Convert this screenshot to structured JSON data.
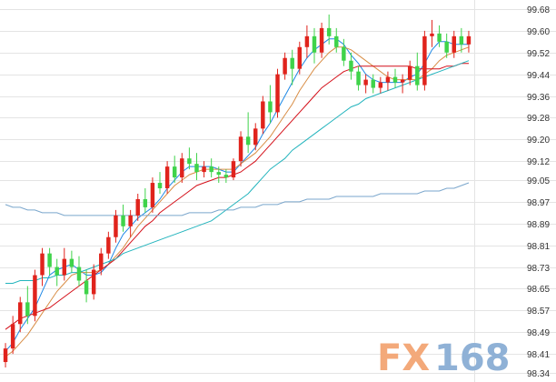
{
  "chart_data": {
    "type": "line",
    "subtype": "candlestick",
    "title": "",
    "xlabel": "",
    "ylabel": "",
    "ylim": [
      98.34,
      99.68
    ],
    "y_ticks": [
      "99.68",
      "99.60",
      "99.52",
      "99.44",
      "99.36",
      "99.28",
      "99.20",
      "99.12",
      "99.05",
      "98.97",
      "98.89",
      "98.81",
      "98.73",
      "98.65",
      "98.57",
      "98.49",
      "98.41",
      "98.34"
    ],
    "y_axis_position": "right",
    "grid": "horizontal",
    "x_labels": [],
    "colors": {
      "up": "#e0231c",
      "down": "#3fd34a",
      "ma5": "#1e88e5",
      "ma10": "#d88d45",
      "ma20": "#d40f19",
      "ma60": "#23b4bd",
      "ma120": "#7aa6cc"
    },
    "series": [
      {
        "kind": "candles",
        "ohlc": [
          [
            98.38,
            98.45,
            98.36,
            98.43
          ],
          [
            98.43,
            98.55,
            98.41,
            98.52
          ],
          [
            98.52,
            98.62,
            98.49,
            98.6
          ],
          [
            98.6,
            98.66,
            98.52,
            98.55
          ],
          [
            98.55,
            98.72,
            98.53,
            98.7
          ],
          [
            98.7,
            98.8,
            98.66,
            98.78
          ],
          [
            98.78,
            98.8,
            98.7,
            98.73
          ],
          [
            98.73,
            98.76,
            98.66,
            98.7
          ],
          [
            98.7,
            98.8,
            98.68,
            98.76
          ],
          [
            98.76,
            98.79,
            98.71,
            98.73
          ],
          [
            98.73,
            98.77,
            98.66,
            98.68
          ],
          [
            98.68,
            98.72,
            98.6,
            98.63
          ],
          [
            98.63,
            98.74,
            98.61,
            98.72
          ],
          [
            98.72,
            98.8,
            98.7,
            98.78
          ],
          [
            98.78,
            98.86,
            98.76,
            98.84
          ],
          [
            98.84,
            98.94,
            98.82,
            98.92
          ],
          [
            98.92,
            98.96,
            98.86,
            98.88
          ],
          [
            98.88,
            98.94,
            98.84,
            98.92
          ],
          [
            98.92,
            99.0,
            98.9,
            98.98
          ],
          [
            98.98,
            99.02,
            98.93,
            98.95
          ],
          [
            98.95,
            99.06,
            98.93,
            99.04
          ],
          [
            99.04,
            99.08,
            99.0,
            99.02
          ],
          [
            99.02,
            99.12,
            99.0,
            99.1
          ],
          [
            99.1,
            99.14,
            99.04,
            99.06
          ],
          [
            99.06,
            99.15,
            99.04,
            99.13
          ],
          [
            99.13,
            99.17,
            99.09,
            99.11
          ],
          [
            99.11,
            99.15,
            99.05,
            99.08
          ],
          [
            99.08,
            99.12,
            99.06,
            99.1
          ],
          [
            99.1,
            99.13,
            99.06,
            99.08
          ],
          [
            99.08,
            99.1,
            99.04,
            99.07
          ],
          [
            99.07,
            99.09,
            99.04,
            99.06
          ],
          [
            99.06,
            99.13,
            99.05,
            99.12
          ],
          [
            99.12,
            99.23,
            99.1,
            99.21
          ],
          [
            99.21,
            99.3,
            99.15,
            99.18
          ],
          [
            99.18,
            99.26,
            99.16,
            99.24
          ],
          [
            99.24,
            99.36,
            99.22,
            99.34
          ],
          [
            99.34,
            99.4,
            99.26,
            99.3
          ],
          [
            99.3,
            99.46,
            99.28,
            99.44
          ],
          [
            99.44,
            99.52,
            99.42,
            99.5
          ],
          [
            99.5,
            99.53,
            99.4,
            99.46
          ],
          [
            99.46,
            99.56,
            99.44,
            99.54
          ],
          [
            99.54,
            99.62,
            99.5,
            99.58
          ],
          [
            99.58,
            99.61,
            99.48,
            99.52
          ],
          [
            99.52,
            99.63,
            99.5,
            99.61
          ],
          [
            99.61,
            99.66,
            99.55,
            99.58
          ],
          [
            99.58,
            99.61,
            99.52,
            99.54
          ],
          [
            99.54,
            99.57,
            99.47,
            99.49
          ],
          [
            99.49,
            99.52,
            99.42,
            99.45
          ],
          [
            99.45,
            99.47,
            99.38,
            99.4
          ],
          [
            99.4,
            99.44,
            99.37,
            99.42
          ],
          [
            99.42,
            99.44,
            99.37,
            99.39
          ],
          [
            99.39,
            99.43,
            99.37,
            99.41
          ],
          [
            99.41,
            99.45,
            99.38,
            99.43
          ],
          [
            99.43,
            99.46,
            99.39,
            99.41
          ],
          [
            99.41,
            99.44,
            99.37,
            99.42
          ],
          [
            99.42,
            99.49,
            99.4,
            99.47
          ],
          [
            99.47,
            99.52,
            99.38,
            99.4
          ],
          [
            99.4,
            99.6,
            99.38,
            99.58
          ],
          [
            99.58,
            99.64,
            99.54,
            99.59
          ],
          [
            99.59,
            99.62,
            99.54,
            99.56
          ],
          [
            99.56,
            99.59,
            99.5,
            99.52
          ],
          [
            99.52,
            99.6,
            99.5,
            99.58
          ],
          [
            99.58,
            99.61,
            99.52,
            99.55
          ],
          [
            99.55,
            99.6,
            99.52,
            99.58
          ]
        ]
      },
      {
        "kind": "line",
        "color_key": "ma5",
        "values": [
          98.42,
          98.45,
          98.5,
          98.54,
          98.58,
          98.64,
          98.7,
          98.72,
          98.73,
          98.74,
          98.72,
          98.7,
          98.7,
          98.71,
          98.74,
          98.8,
          98.85,
          98.88,
          98.91,
          98.93,
          98.95,
          98.98,
          99.02,
          99.05,
          99.08,
          99.1,
          99.1,
          99.1,
          99.1,
          99.09,
          99.08,
          99.08,
          99.11,
          99.14,
          99.17,
          99.22,
          99.26,
          99.31,
          99.36,
          99.41,
          99.46,
          99.5,
          99.53,
          99.55,
          99.57,
          99.57,
          99.55,
          99.51,
          99.48,
          99.44,
          99.42,
          99.41,
          99.41,
          99.41,
          99.41,
          99.43,
          99.44,
          99.48,
          99.53,
          99.56,
          99.56,
          99.55,
          99.55,
          99.55
        ]
      },
      {
        "kind": "line",
        "color_key": "ma10",
        "values": [
          98.4,
          98.42,
          98.45,
          98.48,
          98.52,
          98.56,
          98.6,
          98.64,
          98.67,
          98.7,
          98.71,
          98.71,
          98.71,
          98.72,
          98.74,
          98.77,
          98.8,
          98.84,
          98.88,
          98.91,
          98.94,
          98.97,
          99.0,
          99.03,
          99.05,
          99.07,
          99.08,
          99.09,
          99.09,
          99.09,
          99.09,
          99.09,
          99.11,
          99.13,
          99.15,
          99.18,
          99.21,
          99.25,
          99.29,
          99.33,
          99.38,
          99.42,
          99.46,
          99.49,
          99.52,
          99.54,
          99.54,
          99.53,
          99.51,
          99.49,
          99.47,
          99.45,
          99.43,
          99.42,
          99.42,
          99.42,
          99.42,
          99.44,
          99.46,
          99.49,
          99.51,
          99.52,
          99.53,
          99.54
        ]
      },
      {
        "kind": "line",
        "color_key": "ma20",
        "values": [
          98.5,
          98.52,
          98.54,
          98.55,
          98.56,
          98.57,
          98.58,
          98.6,
          98.62,
          98.64,
          98.66,
          98.68,
          98.7,
          98.72,
          98.74,
          98.76,
          98.79,
          98.82,
          98.85,
          98.88,
          98.9,
          98.93,
          98.95,
          98.97,
          98.99,
          99.01,
          99.03,
          99.04,
          99.05,
          99.06,
          99.06,
          99.07,
          99.08,
          99.1,
          99.12,
          99.15,
          99.18,
          99.21,
          99.24,
          99.27,
          99.3,
          99.33,
          99.36,
          99.39,
          99.41,
          99.43,
          99.45,
          99.46,
          99.47,
          99.47,
          99.47,
          99.47,
          99.47,
          99.47,
          99.47,
          99.47,
          99.46,
          99.46,
          99.46,
          99.46,
          99.47,
          99.47,
          99.48,
          99.48
        ]
      },
      {
        "kind": "line",
        "color_key": "ma60",
        "values": [
          98.67,
          98.67,
          98.68,
          98.68,
          98.68,
          98.69,
          98.69,
          98.7,
          98.7,
          98.71,
          98.71,
          98.72,
          98.73,
          98.74,
          98.75,
          98.76,
          98.78,
          98.79,
          98.8,
          98.81,
          98.82,
          98.83,
          98.84,
          98.85,
          98.86,
          98.87,
          98.88,
          98.89,
          98.9,
          98.92,
          98.94,
          98.96,
          98.98,
          99.0,
          99.03,
          99.06,
          99.09,
          99.11,
          99.13,
          99.16,
          99.18,
          99.2,
          99.22,
          99.24,
          99.26,
          99.28,
          99.3,
          99.32,
          99.33,
          99.35,
          99.36,
          99.37,
          99.38,
          99.39,
          99.4,
          99.41,
          99.42,
          99.43,
          99.44,
          99.45,
          99.46,
          99.47,
          99.48,
          99.49
        ]
      },
      {
        "kind": "line",
        "color_key": "ma120",
        "values": [
          98.96,
          98.95,
          98.95,
          98.94,
          98.94,
          98.93,
          98.93,
          98.93,
          98.92,
          98.92,
          98.92,
          98.92,
          98.92,
          98.92,
          98.92,
          98.92,
          98.92,
          98.92,
          98.92,
          98.92,
          98.92,
          98.92,
          98.92,
          98.92,
          98.92,
          98.93,
          98.93,
          98.93,
          98.93,
          98.94,
          98.94,
          98.94,
          98.95,
          98.95,
          98.95,
          98.96,
          98.96,
          98.96,
          98.97,
          98.97,
          98.97,
          98.98,
          98.98,
          98.98,
          98.98,
          98.99,
          98.99,
          98.99,
          98.99,
          98.99,
          98.99,
          99.0,
          99.0,
          99.0,
          99.0,
          99.0,
          99.0,
          99.01,
          99.01,
          99.01,
          99.02,
          99.02,
          99.03,
          99.04
        ]
      }
    ]
  },
  "watermark": {
    "part1": "FX",
    "part2": "168",
    "color1": "#f3a97a",
    "color2": "#8fb1d6"
  }
}
